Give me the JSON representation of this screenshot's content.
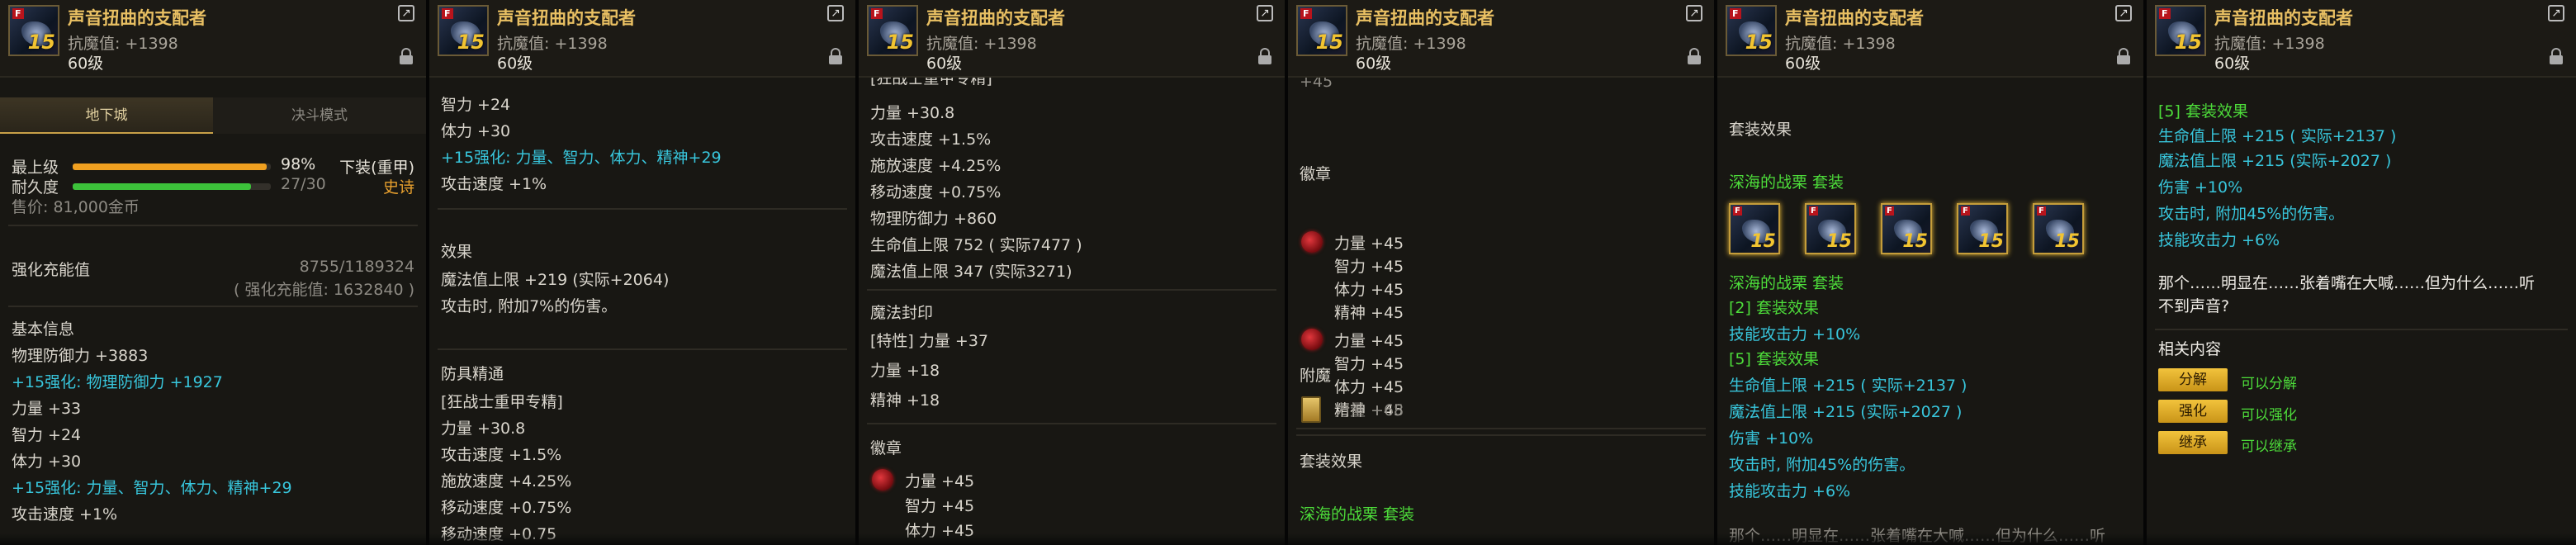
{
  "item": {
    "name": "声音扭曲的支配者",
    "resist": "抗魔值: +1398",
    "level": "60级",
    "icon_badge": "F",
    "icon_level": "15"
  },
  "tabs": [
    "地下城",
    "决斗模式"
  ],
  "stats_top": {
    "grade_label": "最上级",
    "grade_pct": "98%",
    "grade_fraction": 0.98,
    "durability_label": "耐久度",
    "durability_value": "27/30",
    "durability_fraction": 0.9,
    "slot": "下装(重甲)",
    "rarity": "史诗",
    "price": "售价: 81,000金币",
    "reinforce_label": "强化充能值",
    "reinforce_value": "8755/1189324",
    "reinforce_total": "( 强化充能值: 1632840 )"
  },
  "basic": {
    "title": "基本信息",
    "phys_def": "物理防御力 +3883",
    "reinforce_def": "+15强化: 物理防御力 +1927",
    "str": "力量 +33",
    "int": "智力 +24",
    "vit": "体力 +30",
    "reinforce_stats": "+15强化: 力量、智力、体力、精神+29",
    "atk_speed": "攻击速度 +1%"
  },
  "effect": {
    "title": "效果",
    "mp": "魔法值上限 +219 (实际+2064)",
    "desc": "攻击时, 附加7%的伤害。"
  },
  "mastery": {
    "title": "防具精通",
    "tag": "[狂战士重甲专精]",
    "str": "力量 +30.8",
    "atk_speed": "攻击速度 +1.5%",
    "cast_speed": "施放速度 +4.25%",
    "move_speed": "移动速度 +0.75%",
    "phys_def": "物理防御力 +860",
    "hp": "生命值上限 752 ( 实际7477 )",
    "mp": "魔法值上限 347 (实际3271)",
    "move_cut": "移动速度 +0.75"
  },
  "seal": {
    "title": "魔法封印",
    "special": "[特性] 力量 +37",
    "str": "力量 +18",
    "spirit": "精神 +18",
    "cut_top": "[狂战士重甲专精]"
  },
  "emblem": {
    "title": "徽章",
    "str": "力量 +45",
    "int": "智力 +45",
    "vit": "体力 +45",
    "spirit": "精神 +45",
    "cut_vit": "体力 +45",
    "cut_top": "+45"
  },
  "enchant": {
    "title": "附魔",
    "str": "力量 +68"
  },
  "set": {
    "title": "套装效果",
    "name": "深海的战栗 套装",
    "bonus2": "[2] 套装效果",
    "skill_atk": "技能攻击力 +10%",
    "bonus5": "[5] 套装效果",
    "hp": "生命值上限 +215 ( 实际+2137 )",
    "mp": "魔法值上限 +215 (实际+2027 )",
    "dmg": "伤害 +10%",
    "dmg_desc": "攻击时, 附加45%的伤害。",
    "skill_atk6": "技能攻击力 +6%",
    "cut_bottom": "那个……明显在……张着嘴在大喊……但为什么……听"
  },
  "flavor": "那个……明显在……张着嘴在大喊……但为什么……听不到声音?",
  "flavor_line1": "那个……明显在……张着嘴在大喊……但为什么……听",
  "flavor_line2": "不到声音?",
  "related": {
    "title": "相关内容",
    "items": [
      {
        "button": "分解",
        "label": "可以分解"
      },
      {
        "button": "强化",
        "label": "可以强化"
      },
      {
        "button": "继承",
        "label": "可以继承"
      }
    ]
  },
  "colors": {
    "gold": "#e9c063",
    "cyan": "#38c6dc",
    "green": "#4ddc3a",
    "bar_orange": "#f0a020",
    "bar_green": "#3cc23a"
  }
}
